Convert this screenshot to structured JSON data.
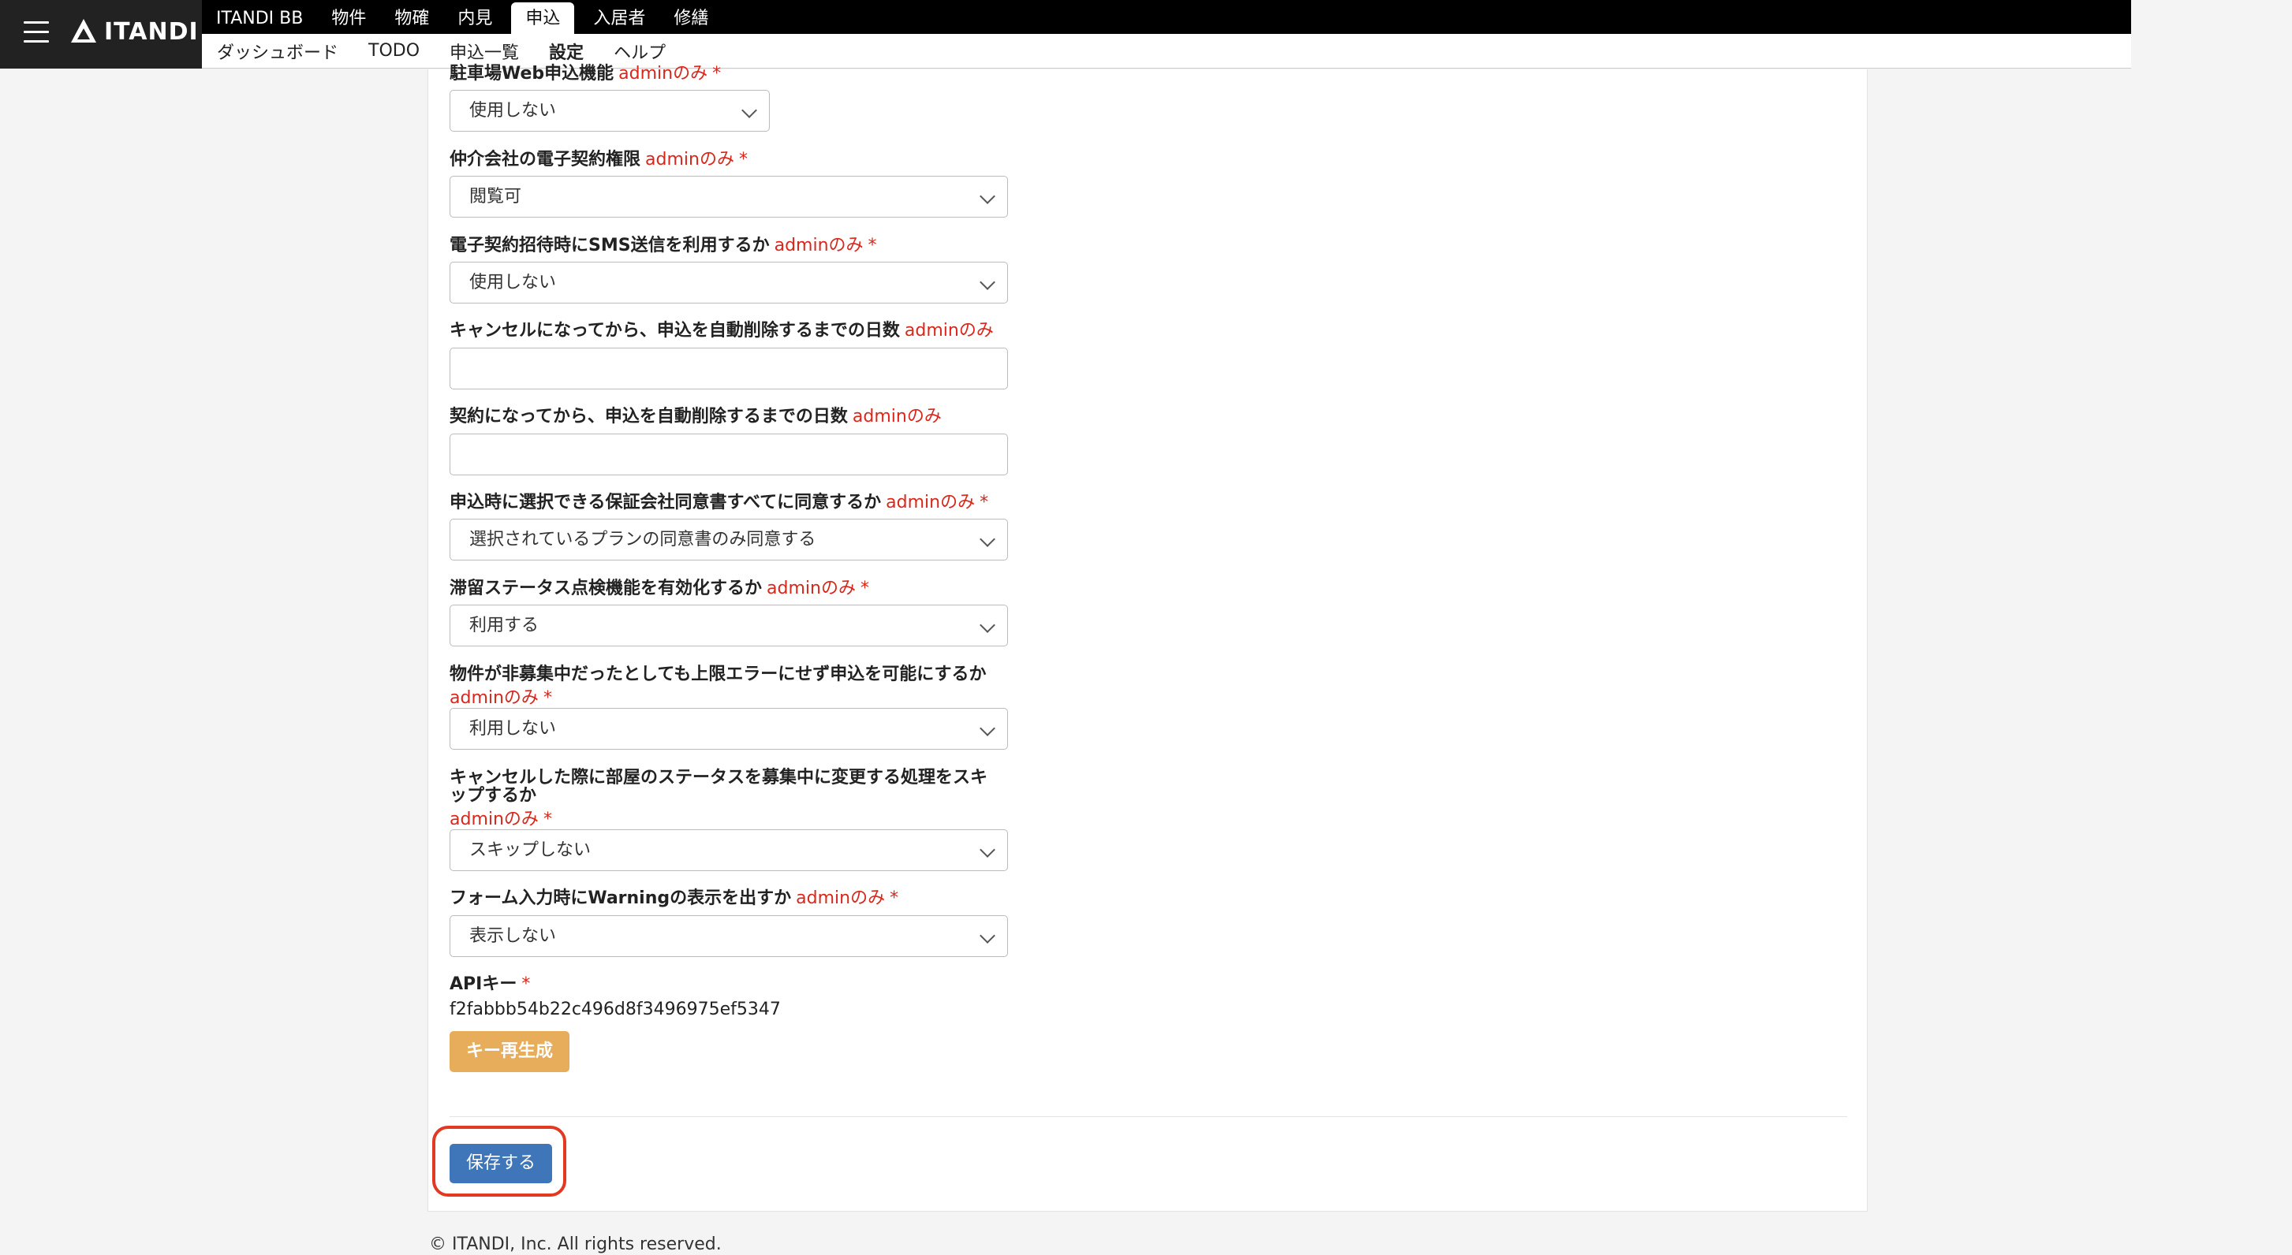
{
  "brand": {
    "name": "ITANDI"
  },
  "main_nav": [
    {
      "label": "ITANDI BB",
      "active": false
    },
    {
      "label": "物件",
      "active": false
    },
    {
      "label": "物確",
      "active": false
    },
    {
      "label": "内見",
      "active": false
    },
    {
      "label": "申込",
      "active": true
    },
    {
      "label": "入居者",
      "active": false
    },
    {
      "label": "修繕",
      "active": false
    }
  ],
  "sub_nav": [
    {
      "label": "ダッシュボード",
      "active": false
    },
    {
      "label": "TODO",
      "active": false
    },
    {
      "label": "申込一覧",
      "active": false
    },
    {
      "label": "設定",
      "active": true
    },
    {
      "label": "ヘルプ",
      "active": false
    }
  ],
  "fields": {
    "parking_web": {
      "label": "駐車場Web申込機能",
      "admin": "adminのみ",
      "req": "*",
      "value": "使用しない"
    },
    "econtract": {
      "label": "仲介会社の電子契約権限",
      "admin": "adminのみ",
      "req": "*",
      "value": "閲覧可"
    },
    "sms": {
      "label": "電子契約招待時にSMS送信を利用するか",
      "admin": "adminのみ",
      "req": "*",
      "value": "使用しない"
    },
    "cancel_days": {
      "label": "キャンセルになってから、申込を自動削除するまでの日数",
      "admin": "adminのみ",
      "value": ""
    },
    "contract_days": {
      "label": "契約になってから、申込を自動削除するまでの日数",
      "admin": "adminのみ",
      "value": ""
    },
    "guarantee": {
      "label": "申込時に選択できる保証会社同意書すべてに同意するか",
      "admin": "adminのみ",
      "req": "*",
      "value": "選択されているプランの同意書のみ同意する"
    },
    "stagnation": {
      "label": "滞留ステータス点検機能を有効化するか",
      "admin": "adminのみ",
      "req": "*",
      "value": "利用する"
    },
    "limit_error": {
      "label": "物件が非募集中だったとしても上限エラーにせず申込を可能にするか",
      "admin": "adminのみ",
      "req": "*",
      "value": "利用しない"
    },
    "skip_status": {
      "label_line1": "キャンセルした際に部屋のステータスを募集中に変更する処理をスキ",
      "label_line2": "ップするか",
      "admin": "adminのみ",
      "req": "*",
      "value": "スキップしない"
    },
    "warning": {
      "label": "フォーム入力時にWarningの表示を出すか",
      "admin": "adminのみ",
      "req": "*",
      "value": "表示しない"
    }
  },
  "api_key": {
    "label": "APIキー",
    "req": "*",
    "value": "f2fabbb54b22c496d8f3496975ef5347",
    "regen_label": "キー再生成"
  },
  "save_label": "保存する",
  "footer": "© ITANDI, Inc. All rights reserved.",
  "colors": {
    "accent_blue": "#3f76b9",
    "warning_orange": "#e8ad5a",
    "required_red": "#d9271b",
    "highlight_red": "#e23a22"
  }
}
